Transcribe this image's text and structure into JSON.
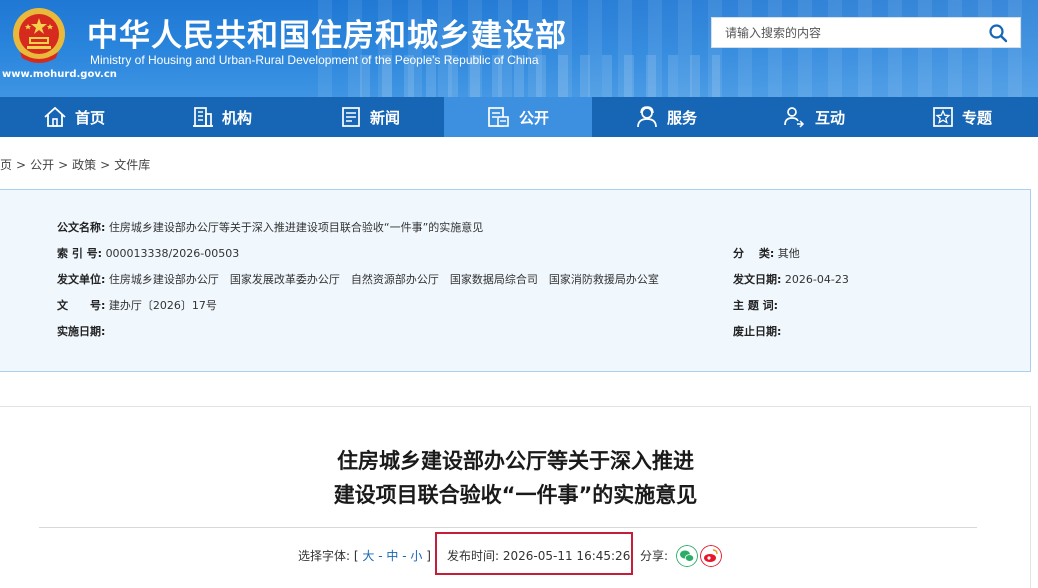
{
  "header": {
    "title": "中华人民共和国住房和城乡建设部",
    "subtitle": "Ministry of Housing and Urban-Rural Development of the People's Republic of China",
    "url": "www.mohurd.gov.cn",
    "search_placeholder": "请输入搜索的内容"
  },
  "nav": {
    "items": [
      {
        "label": "首页",
        "icon": "home-icon"
      },
      {
        "label": "机构",
        "icon": "building-icon"
      },
      {
        "label": "新闻",
        "icon": "news-icon"
      },
      {
        "label": "公开",
        "icon": "public-icon",
        "active": true
      },
      {
        "label": "服务",
        "icon": "user-service-icon"
      },
      {
        "label": "互动",
        "icon": "interaction-icon"
      },
      {
        "label": "专题",
        "icon": "star-icon"
      }
    ]
  },
  "breadcrumb": [
    "页",
    "公开",
    "政策",
    "文件库"
  ],
  "info": {
    "name_label": "公文名称:",
    "name_value": "住房城乡建设部办公厅等关于深入推进建设项目联合验收“一件事”的实施意见",
    "index_label": "索 引 号:",
    "index_value": "000013338/2026-00503",
    "category_label": "分　 类:",
    "category_value": "其他",
    "issuer_label": "发文单位:",
    "issuer_value": "住房城乡建设部办公厅　国家发展改革委办公厅　自然资源部办公厅　国家数据局综合司　国家消防救援局办公室",
    "issue_date_label": "发文日期:",
    "issue_date_value": "2026-04-23",
    "doc_no_label": "文　　号:",
    "doc_no_value": "建办厅〔2026〕17号",
    "subject_label": "主 题 词:",
    "subject_value": "",
    "effective_label": "实施日期:",
    "effective_value": "",
    "expiry_label": "废止日期:",
    "expiry_value": ""
  },
  "article": {
    "title_line1": "住房城乡建设部办公厅等关于深入推进",
    "title_line2": "建设项目联合验收“一件事”的实施意见",
    "font_label": "选择字体:",
    "font_open": "[",
    "font_large": "大",
    "font_dash1": "-",
    "font_medium": "中",
    "font_dash2": "-",
    "font_small": "小",
    "font_close": "]",
    "publish_label": "发布时间:",
    "publish_time": "2026-05-11 16:45:26",
    "share_label": "分享:"
  },
  "colors": {
    "header_blue": "#2b86dd",
    "nav_blue": "#1766b6",
    "nav_active": "#3d8fe0",
    "info_bg": "#f0f7fd",
    "highlight": "#c41e3a",
    "wechat": "#2aae67",
    "weibo": "#e6162d"
  }
}
